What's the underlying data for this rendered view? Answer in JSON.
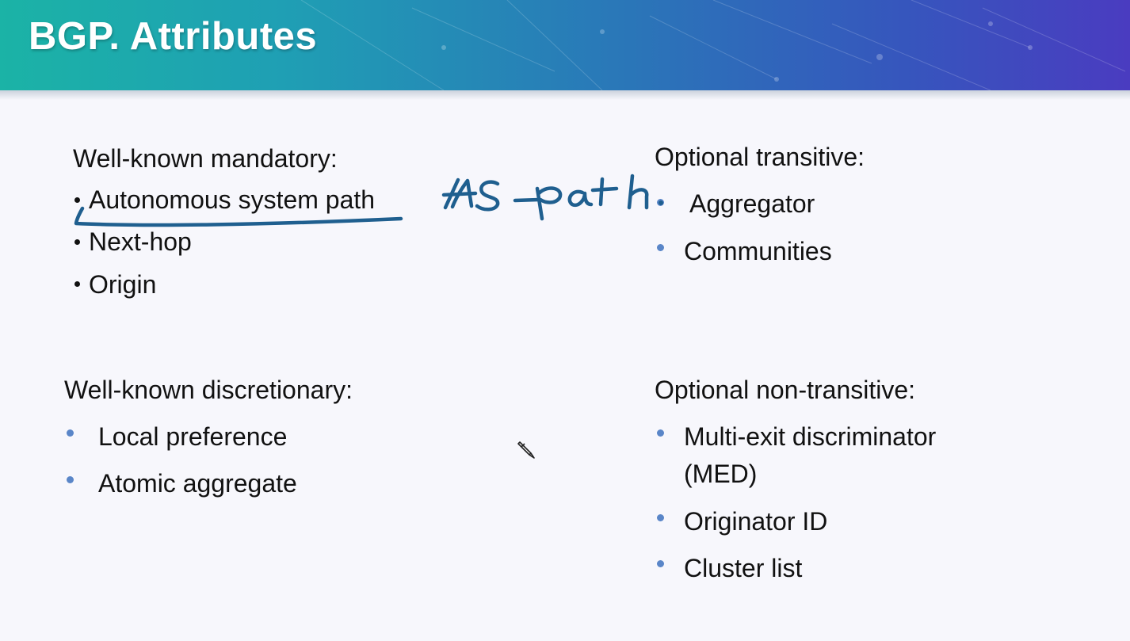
{
  "title": "BGP. Attributes",
  "well_known_mandatory": {
    "heading": "Well-known mandatory:",
    "items": [
      "Autonomous system path",
      "Next-hop",
      "Origin"
    ]
  },
  "optional_transitive": {
    "heading": "Optional transitive:",
    "items": [
      "Aggregator",
      "Communities"
    ]
  },
  "well_known_discretionary": {
    "heading": "Well-known discretionary:",
    "items": [
      "Local preference",
      "Atomic aggregate"
    ]
  },
  "optional_non_transitive": {
    "heading": "Optional non-transitive:",
    "items": [
      "Multi-exit discriminator",
      "(MED)",
      "Originator ID",
      "Cluster list"
    ]
  },
  "annotation": {
    "text": "AS-path",
    "color": "#1f5f8f"
  },
  "colors": {
    "bullet_blue": "#5a86c8",
    "banner_start": "#1bb3a6",
    "banner_end": "#4a3cc0"
  }
}
